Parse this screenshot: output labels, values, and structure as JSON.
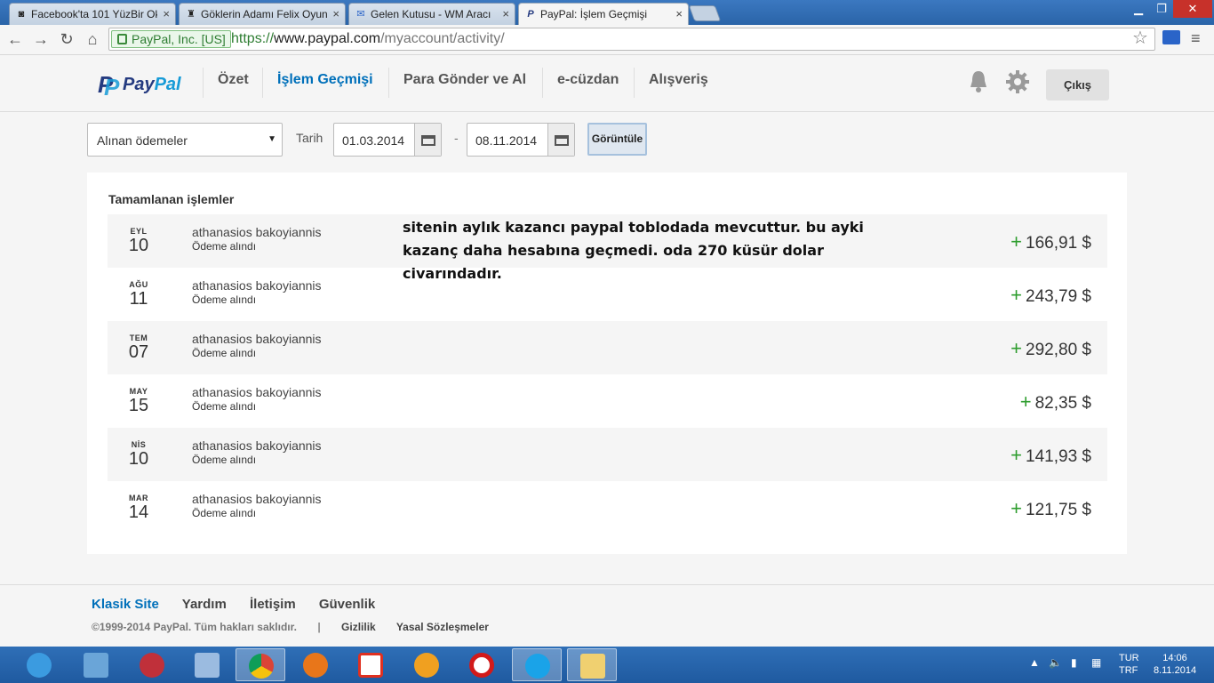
{
  "browser": {
    "tabs": [
      {
        "title": "Facebook'ta 101 YüzBir Ok",
        "favicon": "camera-favicon-icon"
      },
      {
        "title": "Göklerin Adamı Felix Oyun",
        "favicon": "castle-favicon-icon"
      },
      {
        "title": "Gelen Kutusu - WM Aracı",
        "favicon": "mail-favicon-icon"
      },
      {
        "title": "PayPal: İşlem Geçmişi",
        "favicon": "paypal-favicon-icon"
      }
    ],
    "ev_label": "PayPal, Inc. [US]",
    "url_scheme": "https://",
    "url_host": "www.paypal.com",
    "url_path": "/myaccount/activity/"
  },
  "header": {
    "logo_pay": "Pay",
    "logo_pal": "Pal",
    "nav": [
      {
        "label": "Özet",
        "active": false
      },
      {
        "label": "İşlem Geçmişi",
        "active": true
      },
      {
        "label": "Para Gönder ve Al",
        "active": false
      },
      {
        "label": "e-cüzdan",
        "active": false
      },
      {
        "label": "Alışveriş",
        "active": false
      }
    ],
    "logout_label": "Çıkış"
  },
  "filters": {
    "type_selected": "Alınan ödemeler",
    "date_label": "Tarih",
    "date_from": "01.03.2014",
    "date_sep": "-",
    "date_to": "08.11.2014",
    "view_label": "Görüntüle"
  },
  "activity": {
    "title": "Tamamlanan işlemler",
    "rows": [
      {
        "month": "EYL",
        "day": "10",
        "name": "athanasios bakoyiannis",
        "status": "Ödeme alındı",
        "sign": "+",
        "amount": "166,91 $"
      },
      {
        "month": "AĞU",
        "day": "11",
        "name": "athanasios bakoyiannis",
        "status": "Ödeme alındı",
        "sign": "+",
        "amount": "243,79 $"
      },
      {
        "month": "TEM",
        "day": "07",
        "name": "athanasios bakoyiannis",
        "status": "Ödeme alındı",
        "sign": "+",
        "amount": "292,80 $"
      },
      {
        "month": "MAY",
        "day": "15",
        "name": "athanasios bakoyiannis",
        "status": "Ödeme alındı",
        "sign": "+",
        "amount": "82,35 $"
      },
      {
        "month": "NİS",
        "day": "10",
        "name": "athanasios bakoyiannis",
        "status": "Ödeme alındı",
        "sign": "+",
        "amount": "141,93 $"
      },
      {
        "month": "MAR",
        "day": "14",
        "name": "athanasios bakoyiannis",
        "status": "Ödeme alındı",
        "sign": "+",
        "amount": "121,75 $"
      }
    ]
  },
  "annotation": "sitenin aylık kazancı paypal toblodada mevcuttur.  bu ayki kazanç daha hesabına geçmedi. oda 270 küsür dolar civarındadır.",
  "footer": {
    "links": [
      "Klasik Site",
      "Yardım",
      "İletişim",
      "Güvenlik"
    ],
    "copyright": "©1999-2014 PayPal. Tüm hakları saklıdır.",
    "sep": "|",
    "privacy": "Gizlilik",
    "legal": "Yasal Sözleşmeler"
  },
  "taskbar": {
    "apps": [
      {
        "name": "internet-explorer-icon",
        "color": "#3b9be0"
      },
      {
        "name": "remote-desktop-icon",
        "color": "#6aa5d8"
      },
      {
        "name": "media-player-icon",
        "color": "#c0303a"
      },
      {
        "name": "monitor-app-icon",
        "color": "#9bbbe0"
      },
      {
        "name": "chrome-icon",
        "color": "#e8b400"
      },
      {
        "name": "firefox-icon",
        "color": "#e8761a"
      },
      {
        "name": "yandex-icon",
        "color": "#e03020"
      },
      {
        "name": "chat-app-icon",
        "color": "#f0a020"
      },
      {
        "name": "opera-icon",
        "color": "#d21a1a"
      },
      {
        "name": "skype-icon",
        "color": "#1aa3e8"
      },
      {
        "name": "folder-icon",
        "color": "#f0d070"
      }
    ],
    "lang_top": "TUR",
    "lang_bottom": "TRF",
    "time": "14:06",
    "date": "8.11.2014"
  }
}
